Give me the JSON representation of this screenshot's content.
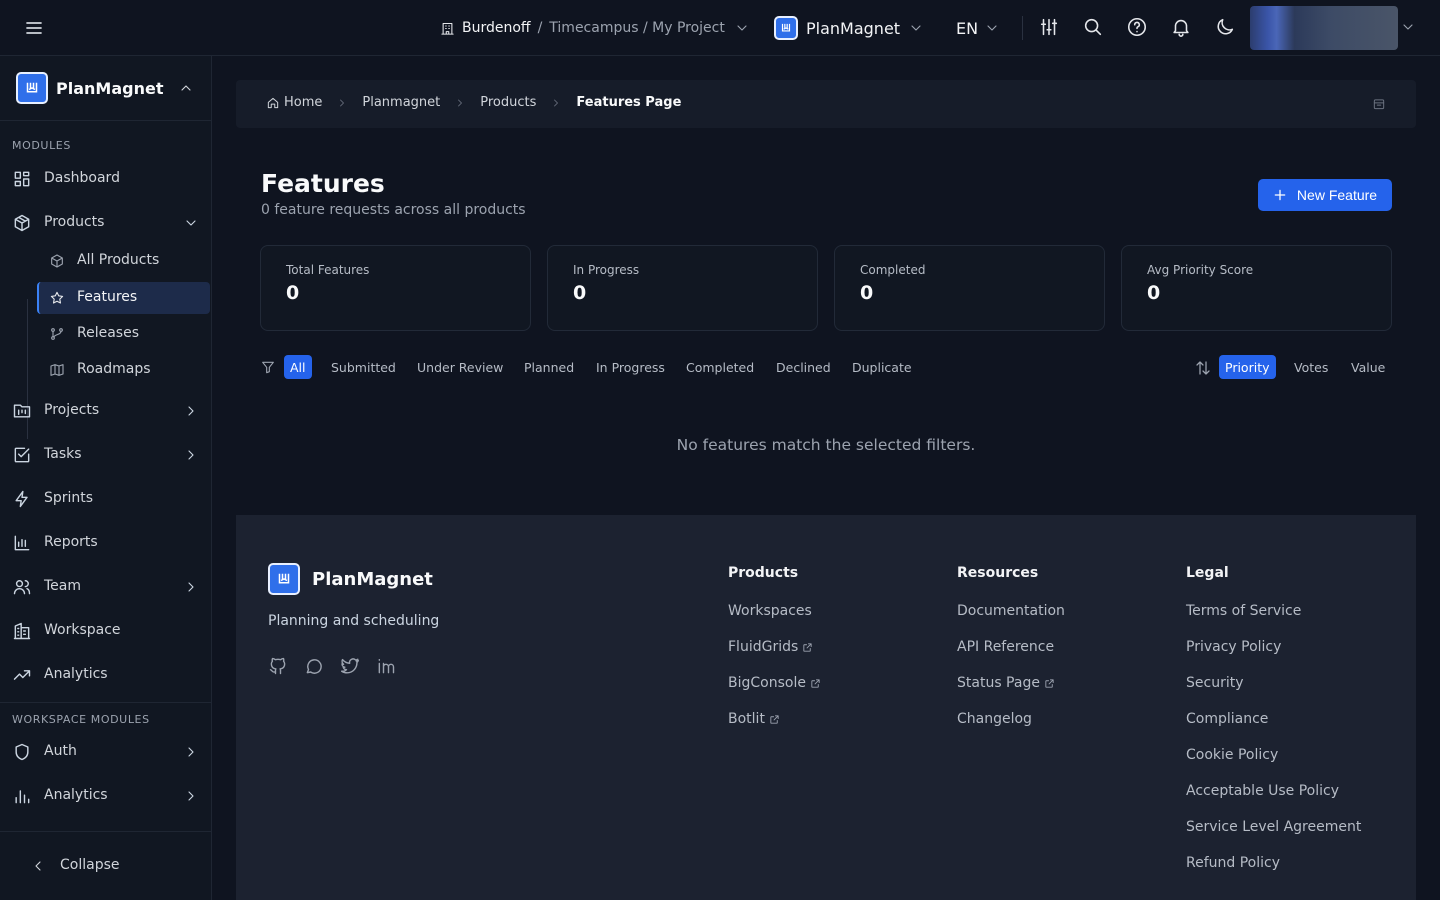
{
  "topbar": {
    "org": "Burdenoff",
    "separator": "/",
    "project_path": "Timecampus / My Project",
    "app_name": "PlanMagnet",
    "language": "EN"
  },
  "sidebar": {
    "brand": "PlanMagnet",
    "modules_heading": "MODULES",
    "items": {
      "dashboard": "Dashboard",
      "products": "Products",
      "projects": "Projects",
      "tasks": "Tasks",
      "sprints": "Sprints",
      "reports": "Reports",
      "team": "Team",
      "workspace": "Workspace",
      "analytics": "Analytics"
    },
    "product_sub": {
      "all_products": "All Products",
      "features": "Features",
      "releases": "Releases",
      "roadmaps": "Roadmaps"
    },
    "workspace_heading": "WORKSPACE MODULES",
    "workspace_items": {
      "auth": "Auth",
      "analytics": "Analytics"
    },
    "collapse": "Collapse"
  },
  "breadcrumb": {
    "home": "Home",
    "planmagnet": "Planmagnet",
    "products": "Products",
    "current": "Features Page"
  },
  "header": {
    "title": "Features",
    "subtitle": "0 feature requests across all products",
    "new_button": "New Feature"
  },
  "stats": [
    {
      "label": "Total Features",
      "value": "0"
    },
    {
      "label": "In Progress",
      "value": "0"
    },
    {
      "label": "Completed",
      "value": "0"
    },
    {
      "label": "Avg Priority Score",
      "value": "0"
    }
  ],
  "filters": {
    "status": [
      "All",
      "Submitted",
      "Under Review",
      "Planned",
      "In Progress",
      "Completed",
      "Declined",
      "Duplicate"
    ],
    "sort": [
      "Priority",
      "Votes",
      "Value"
    ]
  },
  "empty_message": "No features match the selected filters.",
  "footer": {
    "brand": "PlanMagnet",
    "tagline": "Planning and scheduling",
    "columns": {
      "products": {
        "heading": "Products",
        "links": [
          "Workspaces",
          "FluidGrids",
          "BigConsole",
          "Botlit"
        ]
      },
      "resources": {
        "heading": "Resources",
        "links": [
          "Documentation",
          "API Reference",
          "Status Page",
          "Changelog"
        ]
      },
      "legal": {
        "heading": "Legal",
        "links": [
          "Terms of Service",
          "Privacy Policy",
          "Security",
          "Compliance",
          "Cookie Policy",
          "Acceptable Use Policy",
          "Service Level Agreement",
          "Refund Policy"
        ]
      }
    }
  },
  "colors": {
    "accent": "#2563eb",
    "background": "#0f1420",
    "sidebar": "#111722",
    "footer": "#1c2230"
  }
}
